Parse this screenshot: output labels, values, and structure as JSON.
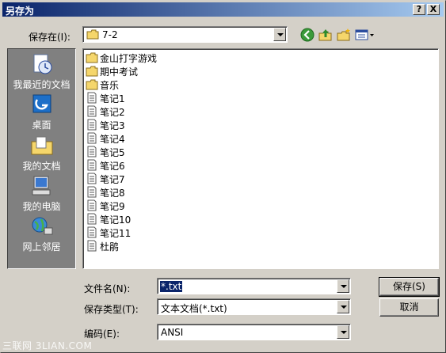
{
  "window": {
    "title": "另存为",
    "help_button": "?",
    "close_button": "X"
  },
  "save_in": {
    "label": "保存在(I):",
    "value": "7-2"
  },
  "toolbar": {
    "icons": [
      "back-icon",
      "up-folder-icon",
      "new-folder-icon",
      "view-menu-icon"
    ]
  },
  "places": [
    {
      "label": "我最近的文档",
      "icon": "recent-documents-icon"
    },
    {
      "label": "桌面",
      "icon": "desktop-icon"
    },
    {
      "label": "我的文档",
      "icon": "my-documents-icon"
    },
    {
      "label": "我的电脑",
      "icon": "my-computer-icon"
    },
    {
      "label": "网上邻居",
      "icon": "network-places-icon"
    }
  ],
  "files": [
    {
      "name": "金山打字游戏",
      "type": "folder"
    },
    {
      "name": "期中考试",
      "type": "folder"
    },
    {
      "name": "音乐",
      "type": "folder"
    },
    {
      "name": "笔记1",
      "type": "text"
    },
    {
      "name": "笔记2",
      "type": "text"
    },
    {
      "name": "笔记3",
      "type": "text"
    },
    {
      "name": "笔记4",
      "type": "text"
    },
    {
      "name": "笔记5",
      "type": "text"
    },
    {
      "name": "笔记6",
      "type": "text"
    },
    {
      "name": "笔记7",
      "type": "text"
    },
    {
      "name": "笔记8",
      "type": "text"
    },
    {
      "name": "笔记9",
      "type": "text"
    },
    {
      "name": "笔记10",
      "type": "text"
    },
    {
      "name": "笔记11",
      "type": "text"
    },
    {
      "name": "杜鹃",
      "type": "text"
    }
  ],
  "filename": {
    "label": "文件名(N):",
    "value": "*.txt"
  },
  "filetype": {
    "label": "保存类型(T):",
    "value": "文本文档(*.txt)"
  },
  "encoding": {
    "label": "编码(E):",
    "value": "ANSI"
  },
  "buttons": {
    "save": "保存(S)",
    "cancel": "取消"
  },
  "watermark": "三联网 3LIAN.COM",
  "colors": {
    "titlebar_start": "#0a246a",
    "titlebar_end": "#a6caf0",
    "face": "#d4d0c8",
    "places_bg": "#808080",
    "selection": "#0a246a"
  }
}
